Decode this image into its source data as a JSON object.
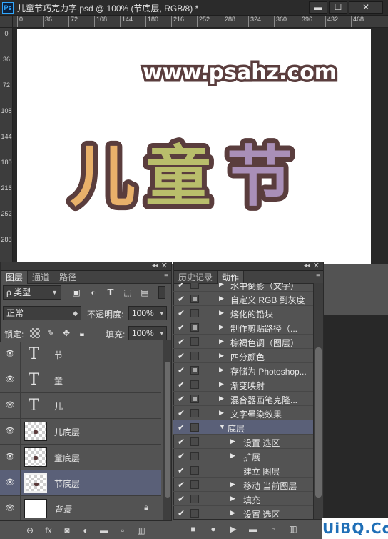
{
  "document": {
    "title": "儿童节巧克力字.psd @ 100% (节底层, RGB/8) *",
    "app_logo": "Ps",
    "window_buttons": {
      "minimize": "▬",
      "maximize": "☐",
      "close": "✕"
    },
    "ruler_top": [
      "0",
      "36",
      "72",
      "108",
      "144",
      "180",
      "216",
      "252",
      "288",
      "324",
      "360",
      "396",
      "432",
      "468"
    ],
    "ruler_left": [
      "0",
      "36",
      "72",
      "108",
      "144",
      "180",
      "216",
      "252",
      "288"
    ],
    "canvas_texts": {
      "website": "www.psahz.com",
      "c1": "儿",
      "c2": "童",
      "c3": "节"
    },
    "canvas_colors": {
      "outline": "#5a3d3d",
      "c1_fill": "#e8b06a",
      "c2_fill": "#b9be6b",
      "c3_fill": "#a98fb8"
    }
  },
  "layers_panel": {
    "topbar": {
      "collapse": "◂◂",
      "close": "✕"
    },
    "tabs": [
      "图层",
      "通道",
      "路径"
    ],
    "menu_icon": "≡",
    "filter_kind": "ρ 类型",
    "blend_mode": "正常",
    "opacity_label": "不透明度:",
    "opacity_value": "100%",
    "lock_label": "锁定:",
    "fill_label": "填充:",
    "fill_value": "100%",
    "layers": [
      {
        "name": "节",
        "type": "text",
        "selected": false
      },
      {
        "name": "童",
        "type": "text",
        "selected": false
      },
      {
        "name": "儿",
        "type": "text",
        "selected": false
      },
      {
        "name": "儿底层",
        "type": "raster",
        "selected": false
      },
      {
        "name": "童底层",
        "type": "raster",
        "selected": false
      },
      {
        "name": "节底层",
        "type": "raster",
        "selected": true
      },
      {
        "name": "背景",
        "type": "background",
        "selected": false
      }
    ],
    "footer_icons": [
      "link-icon",
      "fx-icon",
      "mask-icon",
      "adjustment-icon",
      "folder-icon",
      "new-layer-icon",
      "trash-icon"
    ],
    "footer_glyphs": [
      "⊖",
      "fx",
      "◙",
      "◐",
      "▬",
      "▫",
      "▥"
    ]
  },
  "actions_panel": {
    "tabs": [
      "历史记录",
      "动作"
    ],
    "active_tab": "动作",
    "menu_icon": "≡",
    "items": [
      {
        "label": "水中倒影（文字）",
        "level": 0,
        "dialog": false
      },
      {
        "label": "自定义 RGB 到灰度",
        "level": 0,
        "dialog": true
      },
      {
        "label": "熔化的铅块",
        "level": 0,
        "dialog": false
      },
      {
        "label": "制作剪贴路径（...",
        "level": 0,
        "dialog": true
      },
      {
        "label": "棕褐色调（图层）",
        "level": 0,
        "dialog": false
      },
      {
        "label": "四分颜色",
        "level": 0,
        "dialog": false
      },
      {
        "label": "存储为 Photoshop...",
        "level": 0,
        "dialog": true
      },
      {
        "label": "渐变映射",
        "level": 0,
        "dialog": false
      },
      {
        "label": "混合器画笔克隆...",
        "level": 0,
        "dialog": true
      },
      {
        "label": "文字晕染效果",
        "level": 0,
        "dialog": false
      },
      {
        "label": "底层",
        "level": 0,
        "dialog": false,
        "expanded": true,
        "selected": true
      },
      {
        "label": "设置 选区",
        "level": 1,
        "dialog": false
      },
      {
        "label": "扩展",
        "level": 1,
        "dialog": false
      },
      {
        "label": "建立 图层",
        "level": 1,
        "dialog": false,
        "no_triangle": true
      },
      {
        "label": "移动 当前图层",
        "level": 1,
        "dialog": false
      },
      {
        "label": "填充",
        "level": 1,
        "dialog": false
      },
      {
        "label": "设置 选区",
        "level": 1,
        "dialog": false
      }
    ],
    "footer_glyphs": [
      "■",
      "●",
      "▶",
      "▬",
      "▫",
      "▥"
    ]
  },
  "watermark": "UiBQ.CoM"
}
